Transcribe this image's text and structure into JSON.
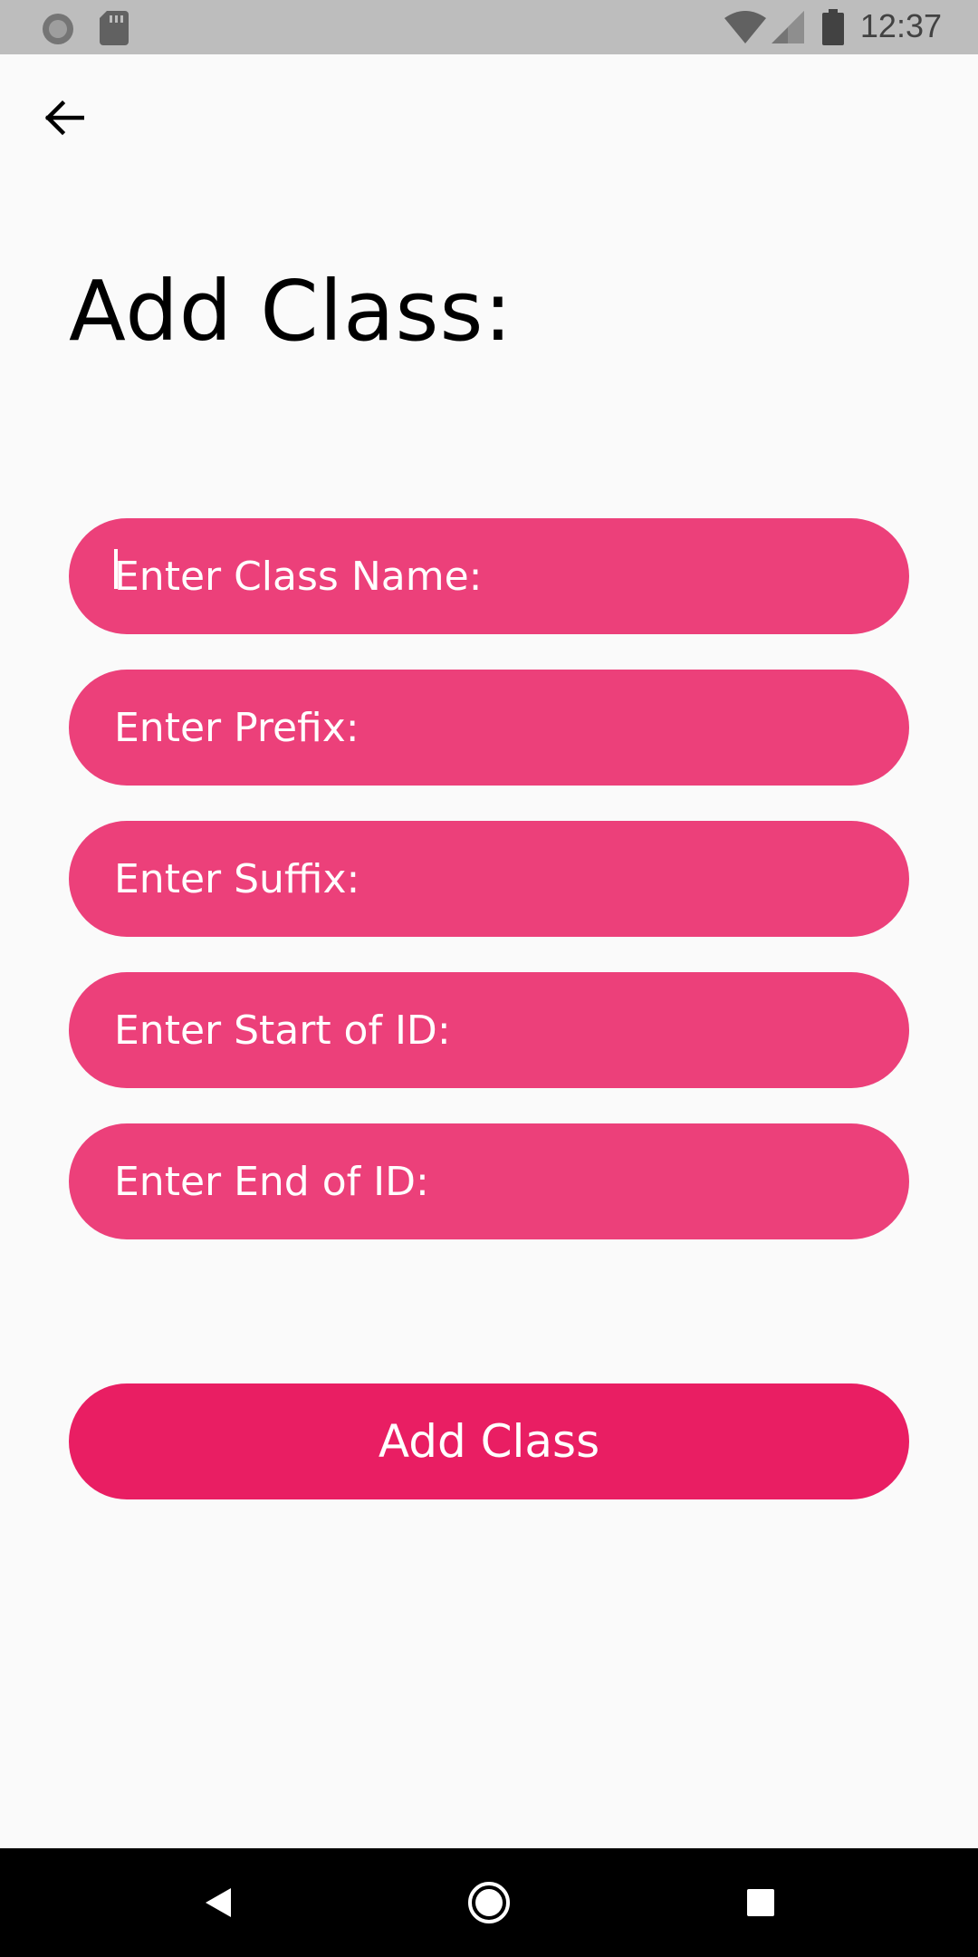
{
  "status_bar": {
    "time": "12:37",
    "icons": [
      "sync-icon",
      "sd-card-icon",
      "wifi-icon",
      "signal-icon",
      "battery-icon"
    ]
  },
  "header": {
    "back_icon": "arrow-left-icon",
    "title": "Add Class:"
  },
  "form": {
    "fields": [
      {
        "placeholder": "Enter Class Name:",
        "value": ""
      },
      {
        "placeholder": "Enter Prefix:",
        "value": ""
      },
      {
        "placeholder": "Enter Suffix:",
        "value": ""
      },
      {
        "placeholder": "Enter Start of ID:",
        "value": ""
      },
      {
        "placeholder": "Enter End of ID:",
        "value": ""
      }
    ],
    "submit_label": "Add Class"
  },
  "nav_bar": {
    "icons": [
      "back-triangle-icon",
      "home-circle-icon",
      "recents-square-icon"
    ]
  },
  "colors": {
    "field_bg": "#ec407a",
    "button_bg": "#e91e63",
    "page_bg": "#fafafa",
    "status_bar_bg": "#bdbdbd"
  }
}
